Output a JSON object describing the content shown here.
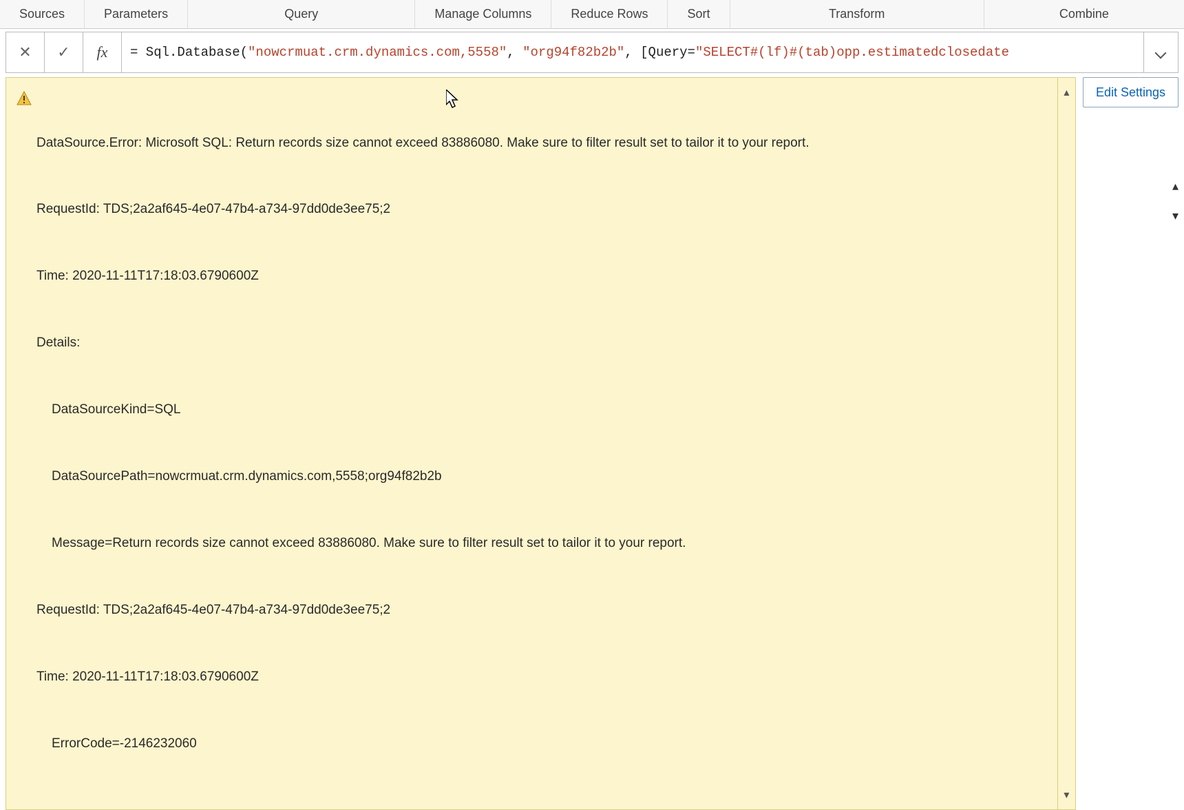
{
  "ribbon": {
    "tabs": [
      "Sources",
      "Parameters",
      "Query",
      "Manage Columns",
      "Reduce Rows",
      "Sort",
      "Transform",
      "Combine"
    ]
  },
  "formula_bar": {
    "cancel_icon": "✕",
    "confirm_icon": "✓",
    "fx_label": "fx",
    "prefix": "= Sql.Database(",
    "str1": "\"nowcrmuat.crm.dynamics.com,5558\"",
    "sep1": ", ",
    "str2": "\"org94f82b2b\"",
    "sep2": ", [Query=",
    "str3": "\"SELECT#(lf)#(tab)opp.estimatedclosedate"
  },
  "error": {
    "line1": "DataSource.Error: Microsoft SQL: Return records size cannot exceed 83886080. Make sure to filter result set to tailor it to your report.",
    "line2": "RequestId: TDS;2a2af645-4e07-47b4-a734-97dd0de3ee75;2",
    "line3": "Time: 2020-11-11T17:18:03.6790600Z",
    "line4": "Details:",
    "line5": "DataSourceKind=SQL",
    "line6": "DataSourcePath=nowcrmuat.crm.dynamics.com,5558;org94f82b2b",
    "line7": "Message=Return records size cannot exceed 83886080. Make sure to filter result set to tailor it to your report.",
    "line8": "RequestId: TDS;2a2af645-4e07-47b4-a734-97dd0de3ee75;2",
    "line9": "Time: 2020-11-11T17:18:03.6790600Z",
    "line10": "ErrorCode=-2146232060"
  },
  "buttons": {
    "edit_settings": "Edit Settings"
  }
}
